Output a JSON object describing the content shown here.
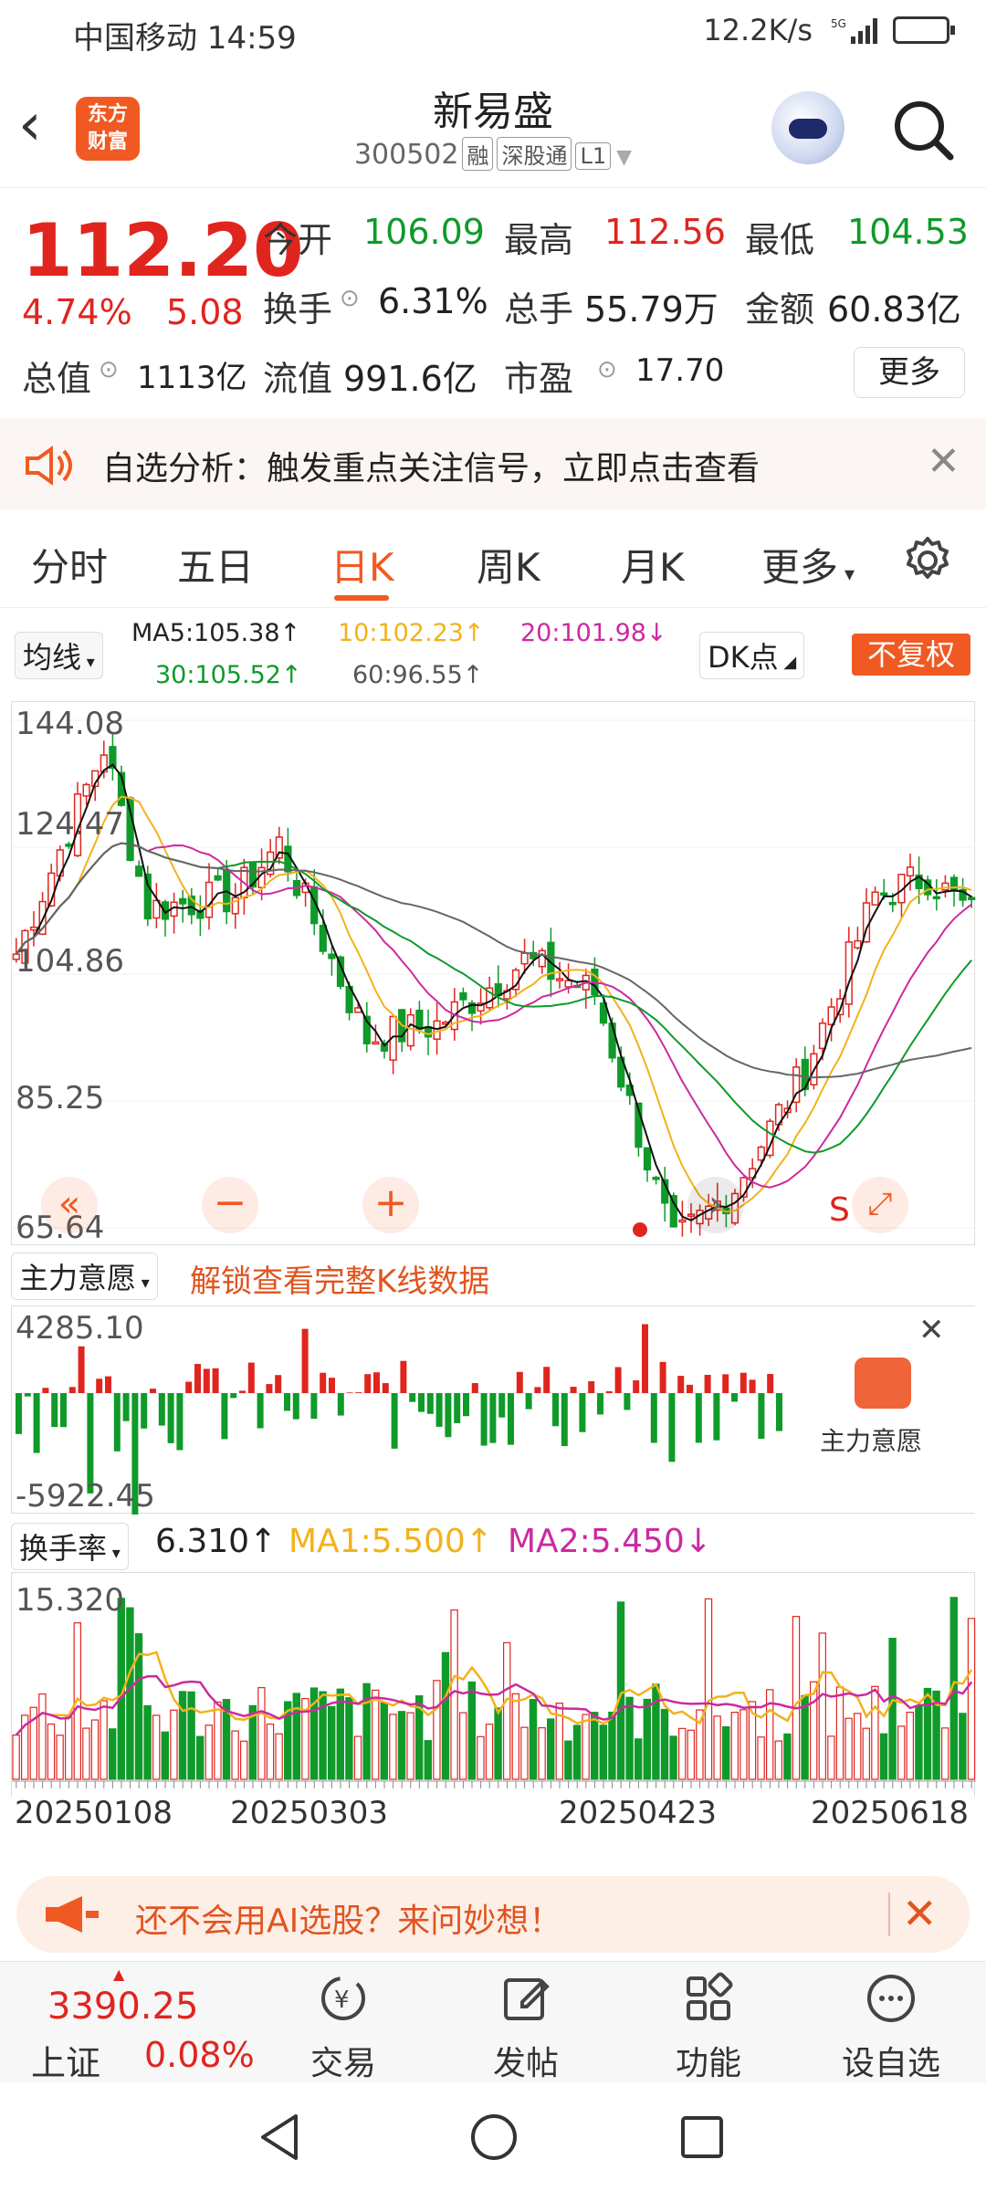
{
  "status": {
    "time": "中国移动 14:59",
    "net": "12.2K/s"
  },
  "header": {
    "title": "新易盛",
    "code": "300502",
    "tags": [
      "融",
      "深股通",
      "L1"
    ],
    "logo_top": "东方",
    "logo_bot": "财富"
  },
  "quote": {
    "price": "112.20",
    "change_pct": "4.74%",
    "change": "5.08",
    "open_label": "今开",
    "open": "106.09",
    "high_label": "最高",
    "high": "112.56",
    "low_label": "最低",
    "low": "104.53",
    "turnover_label": "换手",
    "turnover": "6.31%",
    "volume_label": "总手",
    "volume": "55.79万",
    "amount_label": "金额",
    "amount": "60.83亿",
    "mktcap_label": "总值",
    "mktcap": "1113亿",
    "float_label": "流值",
    "float": "991.6亿",
    "pe_label": "市盈",
    "pe": "17.70",
    "more": "更多"
  },
  "alert": {
    "text": "自选分析：触发重点关注信号，立即点击查看"
  },
  "tabs": [
    "分时",
    "五日",
    "日K",
    "周K",
    "月K",
    "更多"
  ],
  "ma": {
    "selector": "均线",
    "ma5": "MA5:105.38↑",
    "ma10": "10:102.23↑",
    "ma20": "20:101.98↓",
    "ma30": "30:105.52↑",
    "ma60": "60:96.55↑",
    "dk": "DK点",
    "nfq": "不复权"
  },
  "kline": {
    "ticks": [
      "144.08",
      "124.47",
      "104.86",
      "85.25",
      "65.64"
    ],
    "s_label": "S"
  },
  "flow": {
    "selector": "主力意愿",
    "unlock": "解锁查看完整K线数据",
    "max": "4285.10",
    "min": "-5922.45",
    "promo": "主力意愿"
  },
  "turnover_pane": {
    "selector": "换手率",
    "value": "6.310↑",
    "ma1": "MA1:5.500↑",
    "ma2": "MA2:5.450↓",
    "max": "15.320",
    "dates": [
      "20250108",
      "20250303",
      "20250423",
      "20250618"
    ]
  },
  "ai": {
    "text": "还不会用AI选股？来问妙想！"
  },
  "bottom": {
    "index_value": "3390.25",
    "index_name": "上证",
    "index_change": "0.08%",
    "items": [
      "交易",
      "发帖",
      "功能",
      "设自选"
    ]
  },
  "colors": {
    "up": "#e0251f",
    "down": "#0f9a2a",
    "accent": "#f05a22"
  }
}
